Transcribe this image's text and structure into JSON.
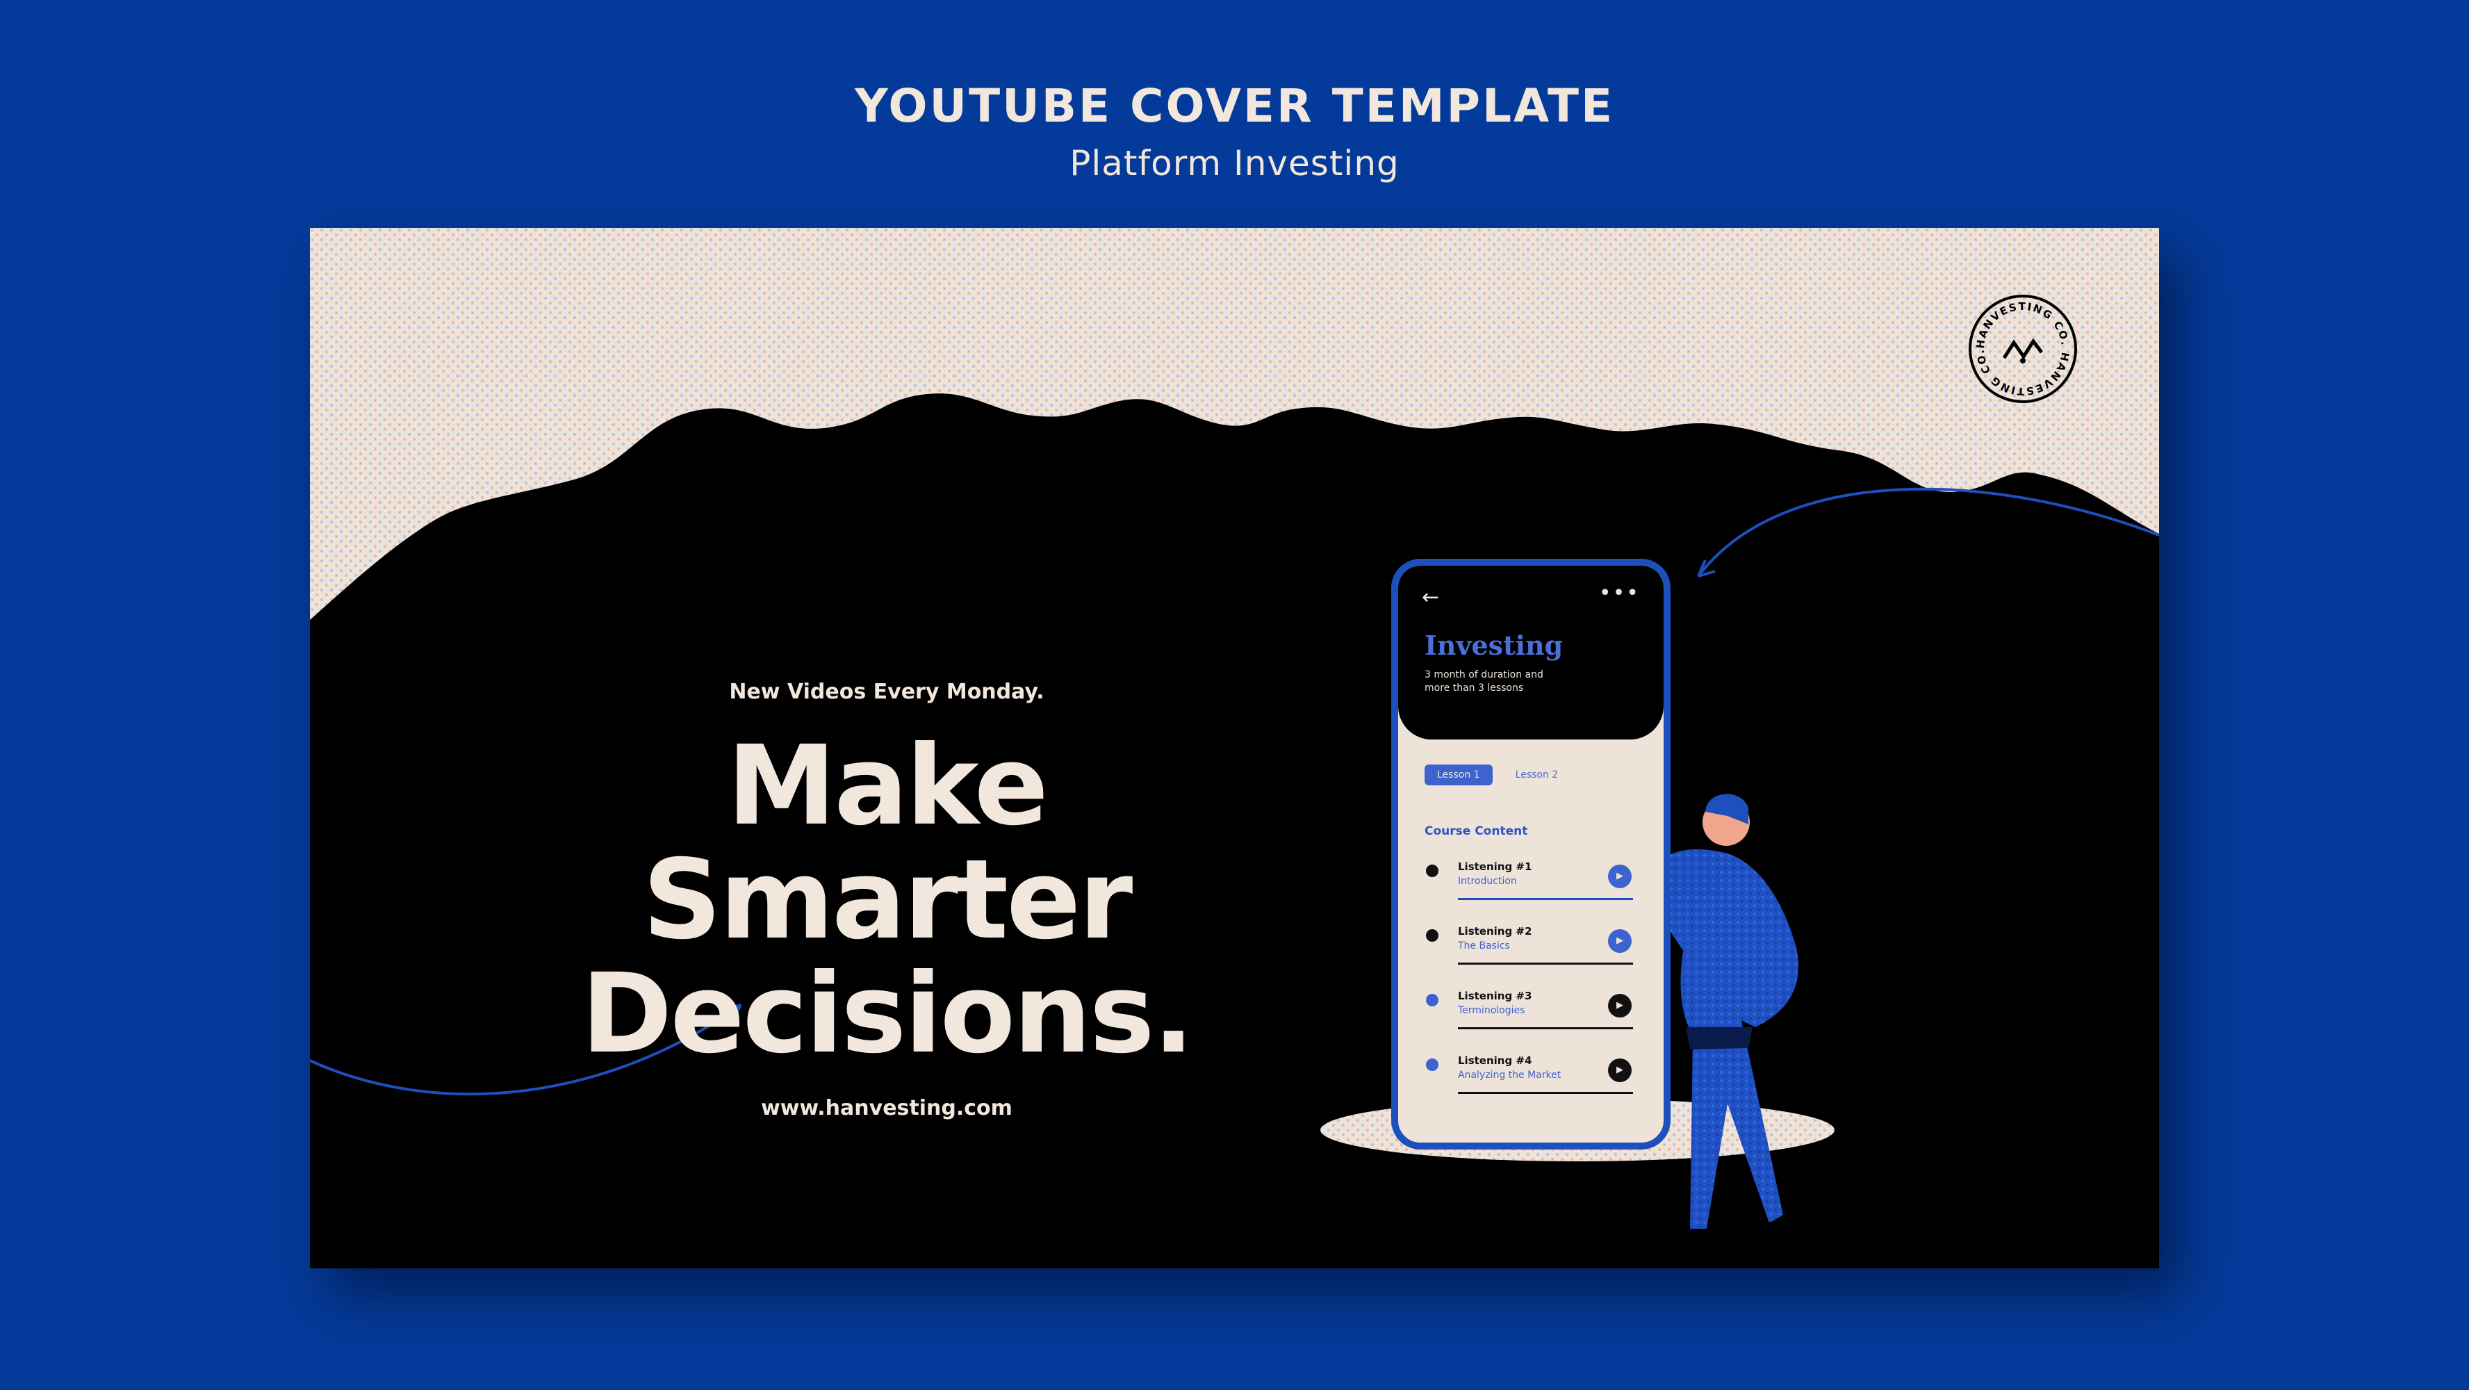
{
  "header": {
    "title": "YOUTUBE COVER TEMPLATE",
    "subtitle": "Platform Investing"
  },
  "cover": {
    "tagline": "New Videos Every Monday.",
    "headline_line1": "Make Smarter",
    "headline_line2": "Decisions.",
    "website": "www.hanvesting.com"
  },
  "badge": {
    "text": "HANVESTING CO. HANVESTING CO."
  },
  "phone": {
    "title": "Investing",
    "description": "3 month of duration and more than 3 lessons",
    "tabs": [
      "Lesson 1",
      "Lesson 2"
    ],
    "active_tab": "Lesson 1",
    "course_title": "Course Content",
    "items": [
      {
        "name": "Listening #1",
        "subtitle": "Introduction"
      },
      {
        "name": "Listening #2",
        "subtitle": "The Basics"
      },
      {
        "name": "Listening #3",
        "subtitle": "Terminologies"
      },
      {
        "name": "Listening #4",
        "subtitle": "Analyzing the Market"
      }
    ]
  },
  "colors": {
    "background": "#043a99",
    "cream": "#f2e7dd",
    "accent_blue": "#1d4fbd",
    "black": "#000000"
  }
}
